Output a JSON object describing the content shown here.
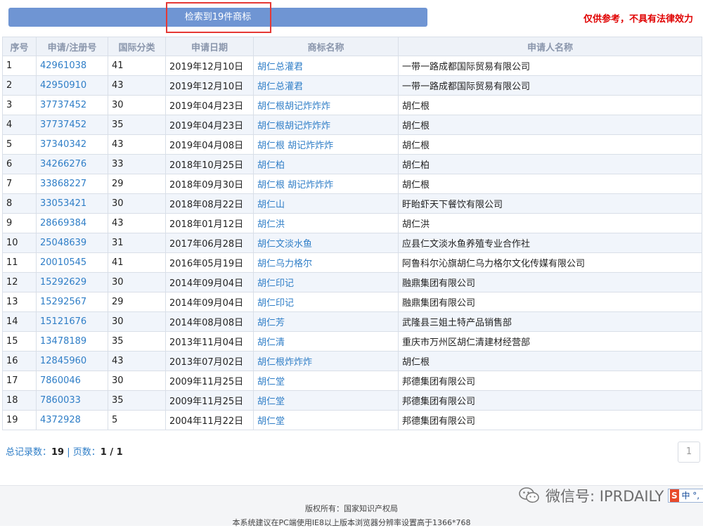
{
  "header": {
    "result_text": "检索到19件商标",
    "disclaimer": "仅供参考，不具有法律效力"
  },
  "table": {
    "columns": [
      "序号",
      "申请/注册号",
      "国际分类",
      "申请日期",
      "商标名称",
      "申请人名称"
    ],
    "rows": [
      [
        "1",
        "42961038",
        "41",
        "2019年12月10日",
        "胡仁总灌君",
        "一带一路成都国际贸易有限公司"
      ],
      [
        "2",
        "42950910",
        "43",
        "2019年12月10日",
        "胡仁总灌君",
        "一带一路成都国际贸易有限公司"
      ],
      [
        "3",
        "37737452",
        "30",
        "2019年04月23日",
        "胡仁根胡记炸炸炸",
        "胡仁根"
      ],
      [
        "4",
        "37737452",
        "35",
        "2019年04月23日",
        "胡仁根胡记炸炸炸",
        "胡仁根"
      ],
      [
        "5",
        "37340342",
        "43",
        "2019年04月08日",
        "胡仁根 胡记炸炸炸",
        "胡仁根"
      ],
      [
        "6",
        "34266276",
        "33",
        "2018年10月25日",
        "胡仁柏",
        "胡仁柏"
      ],
      [
        "7",
        "33868227",
        "29",
        "2018年09月30日",
        "胡仁根 胡记炸炸炸",
        "胡仁根"
      ],
      [
        "8",
        "33053421",
        "30",
        "2018年08月22日",
        "胡仁山",
        "盱眙虾天下餐饮有限公司"
      ],
      [
        "9",
        "28669384",
        "43",
        "2018年01月12日",
        "胡仁洪",
        "胡仁洪"
      ],
      [
        "10",
        "25048639",
        "31",
        "2017年06月28日",
        "胡仁文淡水鱼",
        "应县仁文淡水鱼养殖专业合作社"
      ],
      [
        "11",
        "20010545",
        "41",
        "2016年05月19日",
        "胡仁乌力格尔",
        "阿鲁科尔沁旗胡仁乌力格尔文化传媒有限公司"
      ],
      [
        "12",
        "15292629",
        "30",
        "2014年09月04日",
        "胡仁印记",
        "融鼎集团有限公司"
      ],
      [
        "13",
        "15292567",
        "29",
        "2014年09月04日",
        "胡仁印记",
        "融鼎集团有限公司"
      ],
      [
        "14",
        "15121676",
        "30",
        "2014年08月08日",
        "胡仁芳",
        "武隆县三姐土特产品销售部"
      ],
      [
        "15",
        "13478189",
        "35",
        "2013年11月04日",
        "胡仁清",
        "重庆市万州区胡仁清建材经营部"
      ],
      [
        "16",
        "12845960",
        "43",
        "2013年07月02日",
        "胡仁根炸炸炸",
        "胡仁根"
      ],
      [
        "17",
        "7860046",
        "30",
        "2009年11月25日",
        "胡仁堂",
        "邦德集团有限公司"
      ],
      [
        "18",
        "7860033",
        "35",
        "2009年11月25日",
        "胡仁堂",
        "邦德集团有限公司"
      ],
      [
        "19",
        "4372928",
        "5",
        "2004年11月22日",
        "胡仁堂",
        "邦德集团有限公司"
      ]
    ]
  },
  "summary": {
    "total_label": "总记录数：",
    "total_value": "19",
    "separator": " | ",
    "pages_label": "页数：",
    "pages_value": "1 / 1"
  },
  "pagination": {
    "current_page": "1"
  },
  "footer": {
    "copyright": "版权所有：国家知识产权局",
    "recommendation": "本系统建议在PC端使用IE8以上版本浏览器分辨率设置高于1366*768"
  },
  "watermark": {
    "icon": "wechat-icon",
    "text": "微信号: IPRDAILY"
  },
  "ime": {
    "badge": "S",
    "text": "中 °,"
  },
  "colors": {
    "result_bar": "#6f95d3",
    "highlight_border": "#e53935",
    "disclaimer": "#e00000",
    "link": "#2f7ec7",
    "header_bg": "#eef2f8",
    "alt_row": "#f1f5fb"
  }
}
